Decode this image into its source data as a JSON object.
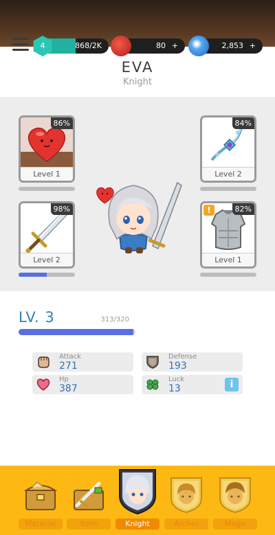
{
  "resources": {
    "player_level": "4",
    "xp": "868/2K",
    "xp_progress": 0.43,
    "meat": "80",
    "meat_plus": "+",
    "gems": "2,853",
    "gems_plus": "+"
  },
  "hero": {
    "name": "EVA",
    "class": "Knight"
  },
  "equipment": [
    {
      "name": "heart",
      "percent": "86%",
      "level": "Level 1",
      "progress": 0.0
    },
    {
      "name": "necklace",
      "percent": "84%",
      "level": "Level 2",
      "progress": 0.0
    },
    {
      "name": "sword",
      "percent": "98%",
      "level": "Level 2",
      "progress": 0.5
    },
    {
      "name": "armor",
      "percent": "82%",
      "level": "Level 1",
      "progress": 0.0,
      "alert": "!"
    }
  ],
  "stats": {
    "level_label": "LV. 3",
    "xp_text": "313/320",
    "xp_progress": 0.98,
    "attack_label": "Attack",
    "attack_value": "271",
    "defense_label": "Defense",
    "defense_value": "193",
    "hp_label": "Hp",
    "hp_value": "387",
    "luck_label": "Luck",
    "luck_value": "13",
    "info_label": "i"
  },
  "nav": [
    {
      "label": "Material",
      "icon": "treasure-chest-icon"
    },
    {
      "label": "Item",
      "icon": "sword-chest-icon"
    },
    {
      "label": "Knight",
      "icon": "knight-portrait-icon",
      "active": true
    },
    {
      "label": "Archer",
      "icon": "archer-portrait-icon"
    },
    {
      "label": "Mage",
      "icon": "mage-portrait-icon"
    }
  ],
  "colors": {
    "accent_blue": "#5b6ee1",
    "stat_value": "#2f6fb7",
    "nav_bg": "#fdb813",
    "nav_active": "#f08a00"
  }
}
